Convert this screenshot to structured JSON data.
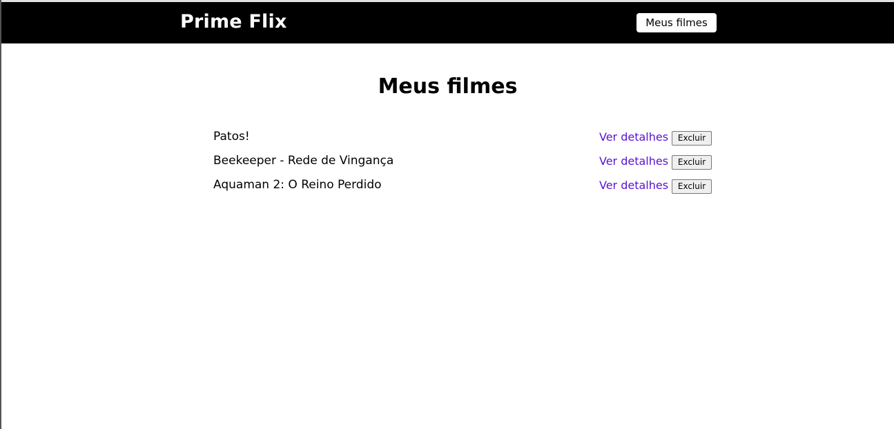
{
  "header": {
    "logo": "Prime Flix",
    "nav_button": "Meus filmes"
  },
  "main": {
    "title": "Meus filmes",
    "movies": [
      {
        "title": "Patos!",
        "details_label": "Ver detalhes",
        "delete_label": "Excluir"
      },
      {
        "title": "Beekeeper - Rede de Vingança",
        "details_label": "Ver detalhes",
        "delete_label": "Excluir"
      },
      {
        "title": "Aquaman 2: O Reino Perdido",
        "details_label": "Ver detalhes",
        "delete_label": "Excluir"
      }
    ]
  },
  "colors": {
    "header_background": "#000000",
    "link": "#5a0fd2"
  }
}
